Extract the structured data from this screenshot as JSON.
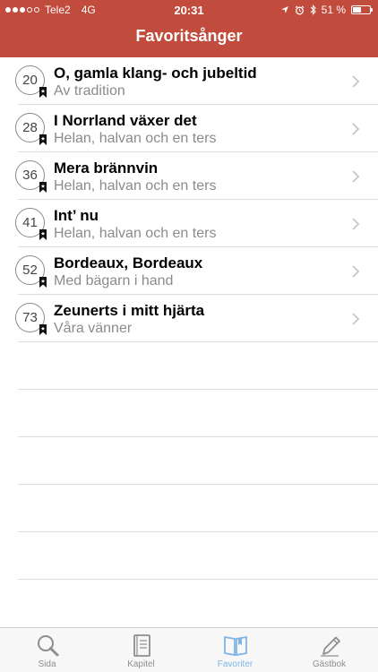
{
  "status_bar": {
    "carrier": "Tele2",
    "network": "4G",
    "time": "20:31",
    "battery": "51 %",
    "battery_level": 0.51
  },
  "header": {
    "title": "Favoritsånger"
  },
  "songs": [
    {
      "number": "20",
      "title": "O, gamla klang- och jubeltid",
      "subtitle": "Av tradition"
    },
    {
      "number": "28",
      "title": "I Norrland växer det",
      "subtitle": "Helan, halvan och en ters"
    },
    {
      "number": "36",
      "title": "Mera brännvin",
      "subtitle": "Helan, halvan och en ters"
    },
    {
      "number": "41",
      "title": "Int’ nu",
      "subtitle": "Helan, halvan och en ters"
    },
    {
      "number": "52",
      "title": "Bordeaux, Bordeaux",
      "subtitle": "Med bägarn i hand"
    },
    {
      "number": "73",
      "title": "Zeunerts i mitt hjärta",
      "subtitle": "Våra vänner"
    }
  ],
  "tabs": [
    {
      "label": "Sida",
      "icon": "magnifier-icon"
    },
    {
      "label": "Kapitel",
      "icon": "book-icon"
    },
    {
      "label": "Favoriter",
      "icon": "open-book-icon",
      "active": true
    },
    {
      "label": "Gästbok",
      "icon": "pencil-icon"
    }
  ],
  "colors": {
    "header_bg": "#c14b3c",
    "active_tab": "#7fb5e6",
    "subtitle": "#8b8b8b"
  }
}
